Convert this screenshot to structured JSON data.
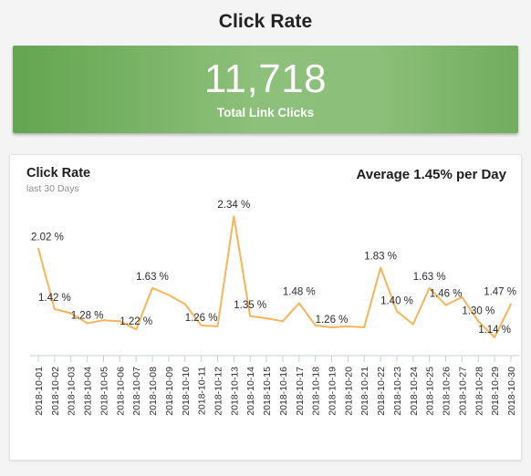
{
  "page": {
    "title": "Click Rate"
  },
  "kpi": {
    "value": "11,718",
    "label": "Total Link Clicks",
    "bg_start": "#63a550",
    "bg_end": "#8dc07a"
  },
  "card": {
    "title": "Click Rate",
    "subtitle": "last 30 Days",
    "average": "Average 1.45% per Day"
  },
  "chart_data": {
    "type": "line",
    "title": "Click Rate",
    "subtitle": "last 30 Days",
    "xlabel": "",
    "ylabel": "",
    "ylim": [
      1.05,
      2.45
    ],
    "grid": false,
    "legend": false,
    "line_color": "#f7b55a",
    "series_name": "Click Rate (%)",
    "unit": "%",
    "categories": [
      "2018-10-01",
      "2018-10-02",
      "2018-10-03",
      "2018-10-04",
      "2018-10-05",
      "2018-10-06",
      "2018-10-07",
      "2018-10-08",
      "2018-10-09",
      "2018-10-10",
      "2018-10-11",
      "2018-10-12",
      "2018-10-13",
      "2018-10-14",
      "2018-10-15",
      "2018-10-16",
      "2018-10-17",
      "2018-10-18",
      "2018-10-19",
      "2018-10-20",
      "2018-10-21",
      "2018-10-22",
      "2018-10-23",
      "2018-10-24",
      "2018-10-25",
      "2018-10-26",
      "2018-10-27",
      "2018-10-28",
      "2018-10-29",
      "2018-10-30"
    ],
    "values": [
      2.02,
      1.42,
      1.38,
      1.28,
      1.31,
      1.3,
      1.22,
      1.63,
      1.56,
      1.47,
      1.26,
      1.25,
      2.34,
      1.35,
      1.33,
      1.3,
      1.48,
      1.26,
      1.24,
      1.25,
      1.24,
      1.83,
      1.4,
      1.27,
      1.63,
      1.46,
      1.54,
      1.3,
      1.14,
      1.47
    ],
    "point_labels": [
      {
        "index": 0,
        "text": "2.02 %"
      },
      {
        "index": 1,
        "text": "1.42 %"
      },
      {
        "index": 3,
        "text": "1.28 %"
      },
      {
        "index": 6,
        "text": "1.22 %"
      },
      {
        "index": 7,
        "text": "1.63 %"
      },
      {
        "index": 10,
        "text": "1.26 %"
      },
      {
        "index": 12,
        "text": "2.34 %"
      },
      {
        "index": 13,
        "text": "1.35 %"
      },
      {
        "index": 16,
        "text": "1.48 %"
      },
      {
        "index": 18,
        "text": "1.26 %"
      },
      {
        "index": 21,
        "text": "1.83 %"
      },
      {
        "index": 22,
        "text": "1.40 %"
      },
      {
        "index": 24,
        "text": "1.63 %"
      },
      {
        "index": 25,
        "text": "1.46 %"
      },
      {
        "index": 27,
        "text": "1.30 %"
      },
      {
        "index": 28,
        "text": "1.14 %"
      },
      {
        "index": 29,
        "text": "1.47 %"
      }
    ],
    "average_value": 1.45
  }
}
